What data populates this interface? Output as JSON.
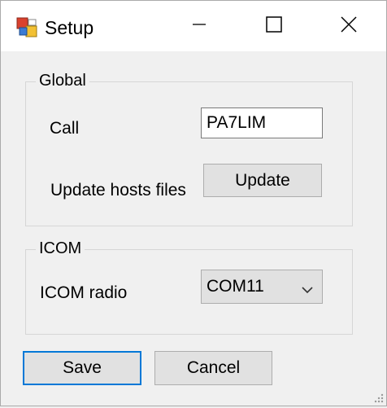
{
  "window": {
    "title": "Setup"
  },
  "global": {
    "group_label": "Global",
    "call_label": "Call",
    "call_value": "PA7LIM",
    "update_label": "Update hosts files",
    "update_button": "Update"
  },
  "icom": {
    "group_label": "ICOM",
    "radio_label": "ICOM radio",
    "radio_selected": "COM11"
  },
  "actions": {
    "save_label": "Save",
    "cancel_label": "Cancel"
  },
  "icons": {
    "app": "setup-app-icon",
    "minimize": "minimize-icon",
    "maximize": "maximize-icon",
    "close": "close-icon",
    "dropdown": "chevron-down-icon"
  }
}
